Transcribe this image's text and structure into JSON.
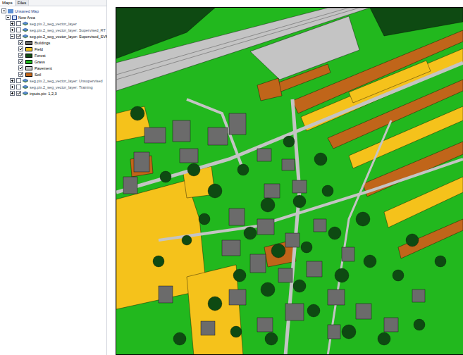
{
  "tabs": [
    {
      "label": "Maps",
      "selected": true
    },
    {
      "label": "Files",
      "selected": false
    }
  ],
  "tree": {
    "label": "Unsaved Map",
    "expanded": true,
    "area": {
      "label": "New Area",
      "expanded": true,
      "layers": [
        {
          "label": "seg.pix.2_seg_vector_layer",
          "checked": false,
          "expanded": false,
          "legend": []
        },
        {
          "label": "seg.pix.2_seg_vector_layer: Supervised_RT",
          "checked": false,
          "expanded": false,
          "legend": []
        },
        {
          "label": "seg.pix.2_seg_vector_layer: Supervised_SVM",
          "checked": true,
          "expanded": true,
          "legend": [
            {
              "label": "Buildings",
              "checked": true,
              "color": "#6b6b6b"
            },
            {
              "label": "Field",
              "checked": true,
              "color": "#f5c21b"
            },
            {
              "label": "Forest",
              "checked": true,
              "color": "#0e4a12"
            },
            {
              "label": "Grass",
              "checked": true,
              "color": "#22b81e"
            },
            {
              "label": "Pavement",
              "checked": true,
              "color": "#c4c4c4"
            },
            {
              "label": "Soil",
              "checked": true,
              "color": "#c0651a"
            }
          ]
        },
        {
          "label": "seg.pix.2_seg_vector_layer: Unsupervised",
          "checked": false,
          "expanded": false,
          "legend": []
        },
        {
          "label": "seg.pix.2_seg_vector_layer: Training",
          "checked": false,
          "expanded": false,
          "legend": []
        },
        {
          "label": "inputs.pix: 1,2,3",
          "checked": true,
          "expanded": false,
          "legend": []
        }
      ]
    }
  }
}
